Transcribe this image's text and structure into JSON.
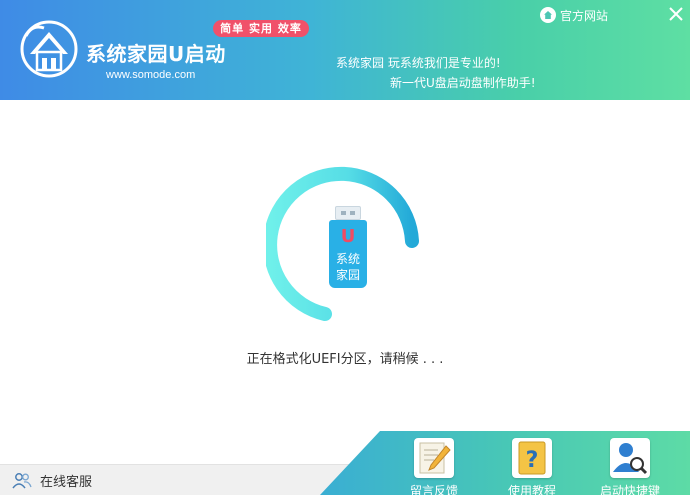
{
  "header": {
    "app_title": "系统家园U启动",
    "app_url": "www.somode.com",
    "badge": "简单 实用 效率",
    "slogan_line1": "系统家园 玩系统我们是专业的!",
    "slogan_line2": "新一代U盘启动盘制作助手!",
    "site_link": "官方网站",
    "close_icon": "close-icon"
  },
  "usb": {
    "letter": "U",
    "line1": "系统",
    "line2": "家园"
  },
  "status": {
    "message": "正在格式化UEFI分区，请稍候 . . ."
  },
  "footer": {
    "service_label": "在线客服",
    "tools": [
      {
        "label": "留言反馈",
        "icon": "feedback-pen-icon"
      },
      {
        "label": "使用教程",
        "icon": "help-question-icon"
      },
      {
        "label": "启动快捷键",
        "icon": "search-user-icon"
      }
    ]
  },
  "colors": {
    "header_start": "#3f8be6",
    "header_end": "#5edfa3",
    "badge": "#f0516a",
    "ring_start": "#6ff0ea",
    "ring_end": "#23a9d8",
    "usb_body": "#29b0e6"
  }
}
